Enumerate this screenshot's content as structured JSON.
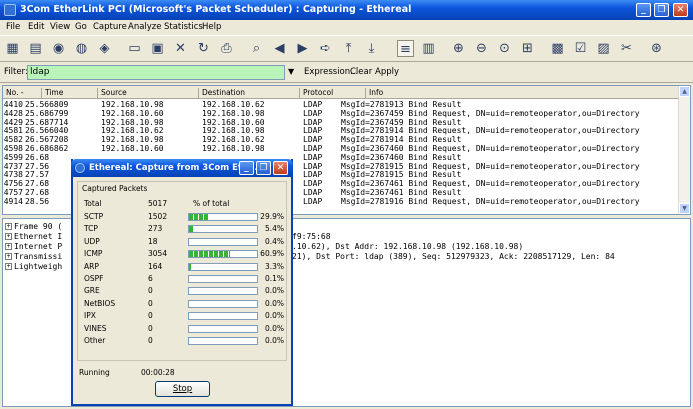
{
  "window": {
    "title": "3Com EtherLink PCI (Microsoft's Packet Scheduler) : Capturing - Ethereal"
  },
  "menu": [
    "File",
    "Edit",
    "View",
    "Go",
    "Capture",
    "Analyze",
    "Statistics",
    "Help"
  ],
  "filter": {
    "label": "Filter:",
    "value": "ldap",
    "expression": "Expression...",
    "clear": "Clear",
    "apply": "Apply"
  },
  "packet_list": {
    "columns": [
      "No. -",
      "Time",
      "Source",
      "Destination",
      "Protocol",
      "Info"
    ],
    "rows": [
      {
        "no": "4410",
        "time": "25.566809",
        "src": "192.168.10.98",
        "dst": "192.168.10.62",
        "proto": "LDAP",
        "info": "MsgId=2781913 Bind Result"
      },
      {
        "no": "4428",
        "time": "25.686799",
        "src": "192.168.10.60",
        "dst": "192.168.10.98",
        "proto": "LDAP",
        "info": "MsgId=2367459 Bind Request, DN=uid=remoteoperator,ou=Directory"
      },
      {
        "no": "4429",
        "time": "25.687714",
        "src": "192.168.10.98",
        "dst": "192.168.10.60",
        "proto": "LDAP",
        "info": "MsgId=2367459 Bind Result"
      },
      {
        "no": "4581",
        "time": "26.566040",
        "src": "192.168.10.62",
        "dst": "192.168.10.98",
        "proto": "LDAP",
        "info": "MsgId=2781914 Bind Request, DN=uid=remoteoperator,ou=Directory"
      },
      {
        "no": "4582",
        "time": "26.567208",
        "src": "192.168.10.98",
        "dst": "192.168.10.62",
        "proto": "LDAP",
        "info": "MsgId=2781914 Bind Result"
      },
      {
        "no": "4598",
        "time": "26.686862",
        "src": "192.168.10.60",
        "dst": "192.168.10.98",
        "proto": "LDAP",
        "info": "MsgId=2367460 Bind Request, DN=uid=remoteoperator,ou=Directory"
      },
      {
        "no": "4599",
        "time": "26.68",
        "src": "",
        "dst": "",
        "proto": "LDAP",
        "info": "MsgId=2367460 Bind Result"
      },
      {
        "no": "4737",
        "time": "27.56",
        "src": "",
        "dst": "",
        "proto": "LDAP",
        "info": "MsgId=2781915 Bind Request, DN=uid=remoteoperator,ou=Directory"
      },
      {
        "no": "4738",
        "time": "27.57",
        "src": "",
        "dst": "",
        "proto": "LDAP",
        "info": "MsgId=2781915 Bind Result"
      },
      {
        "no": "4756",
        "time": "27.68",
        "src": "",
        "dst": "",
        "proto": "LDAP",
        "info": "MsgId=2367461 Bind Request, DN=uid=remoteoperator,ou=Directory"
      },
      {
        "no": "4757",
        "time": "27.68",
        "src": "",
        "dst": "",
        "proto": "LDAP",
        "info": "MsgId=2367461 Bind Result"
      },
      {
        "no": "4914",
        "time": "28.56",
        "src": "",
        "dst": "",
        "proto": "LDAP",
        "info": "MsgId=2781916 Bind Request, DN=uid=remoteoperator,ou=Directory"
      }
    ]
  },
  "details": [
    {
      "label": "Frame 90 (",
      "tail": ""
    },
    {
      "label": "Ethernet I",
      "tail": "f9:75:68"
    },
    {
      "label": "Internet P",
      "tail": ".10.62), Dst Addr: 192.168.10.98 (192.168.10.98)"
    },
    {
      "label": "Transmissi",
      "tail": "21), Dst Port: ldap (389), Seq: 512979323, Ack: 2208517129, Len: 84"
    },
    {
      "label": "Lightweigh",
      "tail": ""
    }
  ],
  "dialog": {
    "title": "Ethereal: Capture from 3Com Eth...",
    "group_label": "Captured Packets",
    "total_label": "Total",
    "total_value": "5017",
    "percent_header": "% of total",
    "protocols": [
      {
        "name": "SCTP",
        "count": "1502",
        "pct": "29.9%",
        "frac": 0.299
      },
      {
        "name": "TCP",
        "count": "273",
        "pct": "5.4%",
        "frac": 0.054
      },
      {
        "name": "UDP",
        "count": "18",
        "pct": "0.4%",
        "frac": 0.004
      },
      {
        "name": "ICMP",
        "count": "3054",
        "pct": "60.9%",
        "frac": 0.609
      },
      {
        "name": "ARP",
        "count": "164",
        "pct": "3.3%",
        "frac": 0.033
      },
      {
        "name": "OSPF",
        "count": "6",
        "pct": "0.1%",
        "frac": 0.001
      },
      {
        "name": "GRE",
        "count": "0",
        "pct": "0.0%",
        "frac": 0
      },
      {
        "name": "NetBIOS",
        "count": "0",
        "pct": "0.0%",
        "frac": 0
      },
      {
        "name": "IPX",
        "count": "0",
        "pct": "0.0%",
        "frac": 0
      },
      {
        "name": "VINES",
        "count": "0",
        "pct": "0.0%",
        "frac": 0
      },
      {
        "name": "Other",
        "count": "0",
        "pct": "0.0%",
        "frac": 0
      }
    ],
    "running_label": "Running",
    "elapsed": "00:00:28",
    "stop_label": "Stop"
  }
}
